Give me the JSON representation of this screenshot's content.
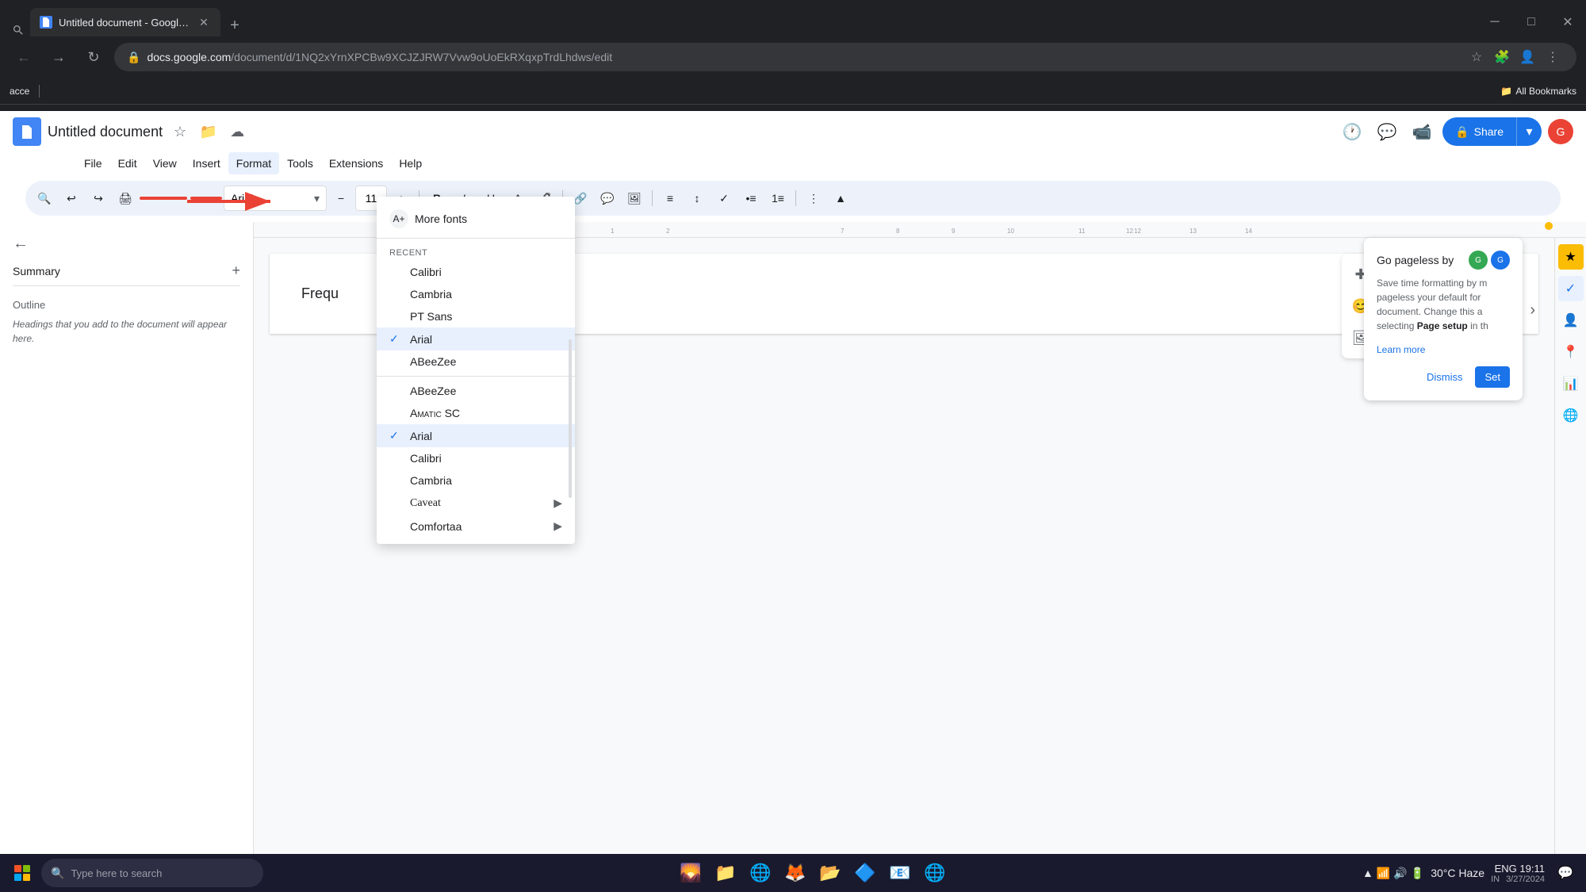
{
  "browser": {
    "tab": {
      "title": "Untitled document - Google D...",
      "favicon": "📄"
    },
    "address": {
      "lock": "🔒",
      "full": "docs.google.com/document/d/1NQ2xYrnXPCBw9XCJZJRW7Vvw9oUoEkRXqxpTrdLhdws/edit",
      "protocol": "docs.google.com",
      "path": "/document/d/1NQ2xYrnXPCBw9XCJZJRW7Vvw9oUoEkRXqxpTrdLhdws/edit"
    },
    "bookmarks_label": "All Bookmarks",
    "acce_label": "acce"
  },
  "docs": {
    "title": "Untitled document",
    "menu": [
      "File",
      "Edit",
      "View",
      "Insert",
      "Format",
      "Tools",
      "Extensions",
      "Help"
    ],
    "toolbar": {
      "font": "Arial",
      "font_size": "11",
      "bold": "B",
      "italic": "I",
      "underline": "U"
    },
    "sidebar": {
      "back_label": "←",
      "summary_label": "Summary",
      "add_label": "+",
      "outline_label": "Outline",
      "outline_hint": "Headings that you add to the document will appear here."
    },
    "doc_content": {
      "partial_text": "Frequ"
    },
    "pageless": {
      "title": "Go pageless by",
      "body": "Save time formatting by m pageless your default for document. Change this a selecting ",
      "bold_part": "Page setup",
      "body_after": " in th",
      "learn_more": "Learn more",
      "dismiss": "Dismiss",
      "set": "Set"
    }
  },
  "font_dropdown": {
    "more_fonts_label": "More fonts",
    "recent_label": "RECENT",
    "recent_fonts": [
      "Calibri",
      "Cambria",
      "PT Sans"
    ],
    "arial_selected": "Arial",
    "abeezee_recent": "ABeeZee",
    "all_fonts_section": [
      {
        "name": "ABeeZee",
        "selected": false
      },
      {
        "name": "AMATIC SC",
        "style": "small-caps",
        "selected": false
      },
      {
        "name": "Arial",
        "selected": true
      },
      {
        "name": "Calibri",
        "selected": false
      },
      {
        "name": "Cambria",
        "selected": false
      },
      {
        "name": "Caveat",
        "has_arrow": true,
        "selected": false
      },
      {
        "name": "Comfortaa",
        "has_arrow": true,
        "selected": false
      }
    ]
  },
  "taskbar": {
    "search_placeholder": "Type here to search",
    "weather": "30°C Haze",
    "lang": "ENG",
    "country": "IN",
    "time": "19:11",
    "date": "3/27/2024"
  }
}
